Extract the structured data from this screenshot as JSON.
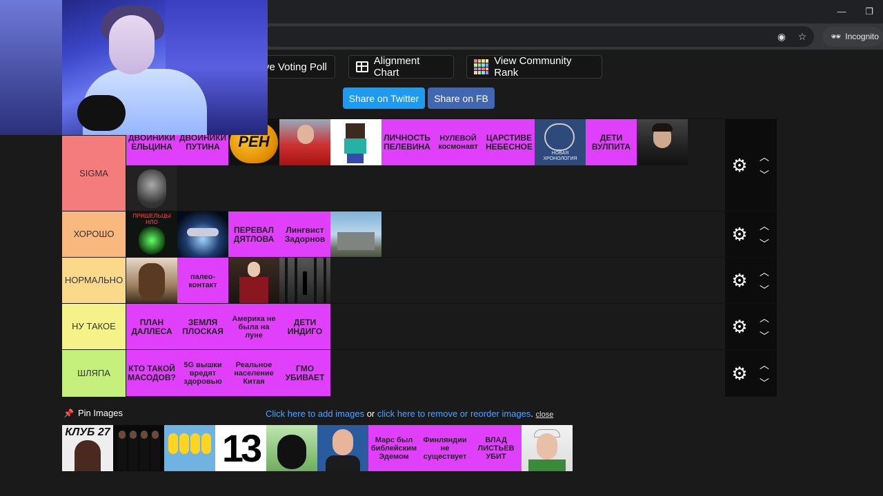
{
  "browser": {
    "incognito_label": "Incognito",
    "minimize_icon": "minimize-icon",
    "maximize_icon": "maximize-icon"
  },
  "toolbar": {
    "poll_label": "ve Voting Poll",
    "alignment_label": "Alignment Chart",
    "community_label": "View Community Rank",
    "share_twitter": "Share on Twitter",
    "share_fb": "Share on FB"
  },
  "tiers": [
    {
      "label": "SIGMA",
      "color": "#f47c7c",
      "items": [
        {
          "type": "text",
          "text": "ДВОИНИКИ ЕЛЬЦИНА"
        },
        {
          "type": "text",
          "text": "ДВОЙНИКИ ПУТИНА"
        },
        {
          "type": "image",
          "icon": "ren-tv-logo",
          "text": "РЕН"
        },
        {
          "type": "image",
          "icon": "man-red-sweater"
        },
        {
          "type": "image",
          "icon": "minecraft-herobrine"
        },
        {
          "type": "text",
          "text": "ЛИЧНОСТЬ ПЕЛЕВИНА"
        },
        {
          "type": "text",
          "text": "НУЛЕВОЙ космонавт"
        },
        {
          "type": "text",
          "text": "ЦАРСТИВЕ НЕБЕСНОЕ"
        },
        {
          "type": "image",
          "icon": "book-novaya-hronologiya",
          "text": "НОВАЯ ХРОНОЛОГИЯ"
        },
        {
          "type": "text",
          "text": "ДЕТИ ВУЛПИТА"
        },
        {
          "type": "image",
          "icon": "harry-potter"
        },
        {
          "type": "image",
          "icon": "alien-figure"
        }
      ]
    },
    {
      "label": "ХОРОШО",
      "color": "#f8b87e",
      "items": [
        {
          "type": "image",
          "icon": "ufo-book-cover",
          "text": "ПРИШЕЛЬЦЫ НЛО"
        },
        {
          "type": "image",
          "icon": "ufo-photo"
        },
        {
          "type": "text",
          "text": "ПЕРЕВАЛ ДЯТЛОВА"
        },
        {
          "type": "text",
          "text": "Лингвист Задорнов"
        },
        {
          "type": "image",
          "icon": "chernobyl-plant"
        }
      ]
    },
    {
      "label": "НОРМАЛЬНО",
      "color": "#fbd98a",
      "items": [
        {
          "type": "image",
          "icon": "werewolf"
        },
        {
          "type": "text",
          "text": "палео-контакт"
        },
        {
          "type": "image",
          "icon": "michael-jackson"
        },
        {
          "type": "image",
          "icon": "slenderman-forest"
        }
      ]
    },
    {
      "label": "НУ ТАКОЕ",
      "color": "#f6f28a",
      "items": [
        {
          "type": "text",
          "text": "ПЛАН ДАЛЛЕСА"
        },
        {
          "type": "text",
          "text": "ЗЕМЛЯ ПЛОСКАЯ"
        },
        {
          "type": "text",
          "text": "Америка не была на луне"
        },
        {
          "type": "text",
          "text": "ДЕТИ ИНДИГО"
        }
      ]
    },
    {
      "label": "ШЛЯПА",
      "color": "#c6f07c",
      "items": [
        {
          "type": "text",
          "text": "КТО ТАКОЙ МАСОДОВ?"
        },
        {
          "type": "text",
          "text": "5G вышки вредят здоровью"
        },
        {
          "type": "text",
          "text": "Реальное население Китая"
        },
        {
          "type": "text",
          "text": "ГМО УБИВАЕТ"
        }
      ]
    }
  ],
  "pin": {
    "label": "Pin Images",
    "link_add": "Click here to add images",
    "or": " or ",
    "link_remove": "click here to remove or reorder images",
    "period": ". ",
    "close": "close",
    "items": [
      {
        "type": "image",
        "icon": "klub-27",
        "text": "КЛУБ 27"
      },
      {
        "type": "image",
        "icon": "men-in-black"
      },
      {
        "type": "image",
        "icon": "simpsons"
      },
      {
        "type": "image",
        "icon": "number-13",
        "text": "13"
      },
      {
        "type": "image",
        "icon": "black-cat"
      },
      {
        "type": "image",
        "icon": "zuckerberg"
      },
      {
        "type": "text",
        "text": "Марс был библейским Эдемом"
      },
      {
        "type": "text",
        "text": "Финляндии не существует"
      },
      {
        "type": "text",
        "text": "ВЛАД ЛИСТЬЕВ УБИТ"
      },
      {
        "type": "image",
        "icon": "old-man-white-cap"
      }
    ]
  },
  "colors": {
    "accent_pink": "#e040fb",
    "twitter_blue": "#1d9bf0",
    "fb_blue": "#4267b2",
    "link_blue": "#4aa3ff"
  }
}
